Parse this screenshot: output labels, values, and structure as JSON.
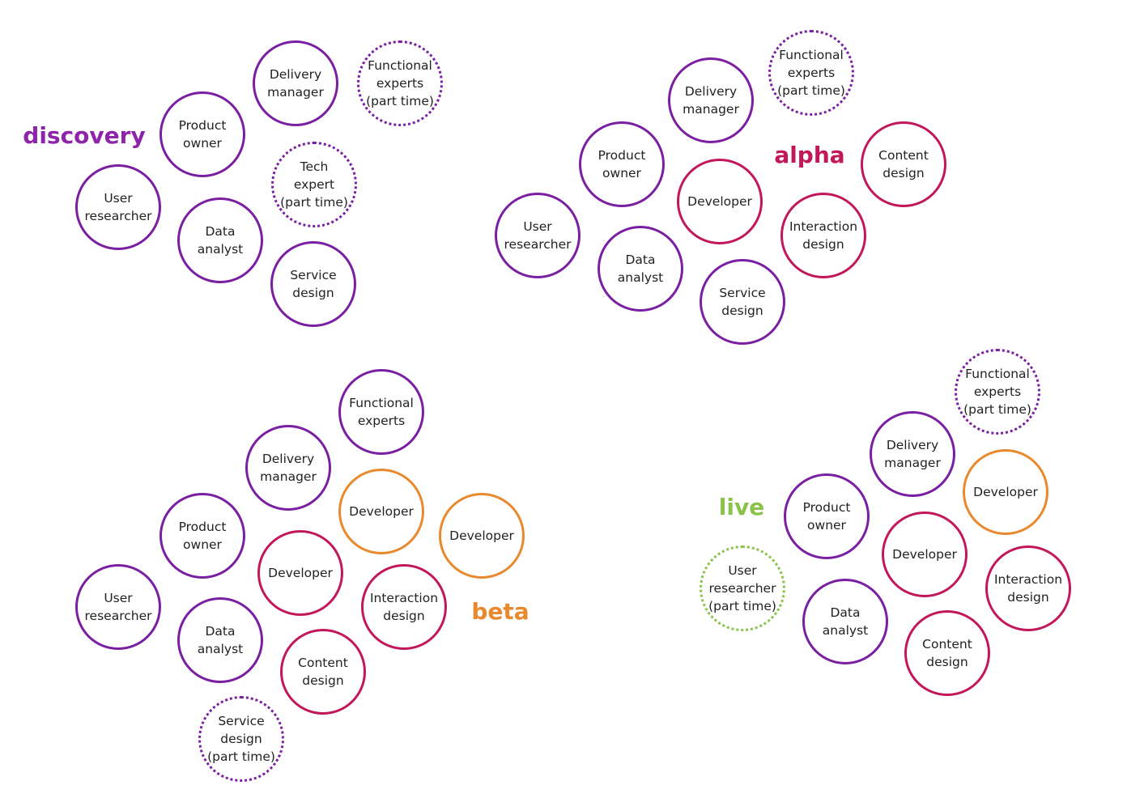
{
  "colors": {
    "purple": "#7B1FA2",
    "magenta": "#C2185B",
    "orange": "#E8892D",
    "green": "#8BC34A",
    "discovery_title": "#8E24AA",
    "alpha_title": "#C2185B",
    "beta_title": "#E8892D",
    "live_title": "#8BC34A"
  },
  "phases": [
    {
      "id": "discovery",
      "title": "discovery",
      "roles": [
        {
          "label": "Delivery\nmanager",
          "color": "purple",
          "style": "solid"
        },
        {
          "label": "Functional\nexperts\n(part time)",
          "color": "purple",
          "style": "dotted"
        },
        {
          "label": "Product\nowner",
          "color": "purple",
          "style": "solid"
        },
        {
          "label": "Tech\nexpert\n(part time)",
          "color": "purple",
          "style": "dotted"
        },
        {
          "label": "User\nresearcher",
          "color": "purple",
          "style": "solid"
        },
        {
          "label": "Data\nanalyst",
          "color": "purple",
          "style": "solid"
        },
        {
          "label": "Service\ndesign",
          "color": "purple",
          "style": "solid"
        }
      ]
    },
    {
      "id": "alpha",
      "title": "alpha",
      "roles": [
        {
          "label": "Functional\nexperts\n(part time)",
          "color": "purple",
          "style": "dotted"
        },
        {
          "label": "Delivery\nmanager",
          "color": "purple",
          "style": "solid"
        },
        {
          "label": "Product\nowner",
          "color": "purple",
          "style": "solid"
        },
        {
          "label": "Developer",
          "color": "magenta",
          "style": "solid"
        },
        {
          "label": "Content\ndesign",
          "color": "magenta",
          "style": "solid"
        },
        {
          "label": "Interaction\ndesign",
          "color": "magenta",
          "style": "solid"
        },
        {
          "label": "User\nresearcher",
          "color": "purple",
          "style": "solid"
        },
        {
          "label": "Data\nanalyst",
          "color": "purple",
          "style": "solid"
        },
        {
          "label": "Service\ndesign",
          "color": "purple",
          "style": "solid"
        }
      ]
    },
    {
      "id": "beta",
      "title": "beta",
      "roles": [
        {
          "label": "Functional\nexperts",
          "color": "purple",
          "style": "solid"
        },
        {
          "label": "Delivery\nmanager",
          "color": "purple",
          "style": "solid"
        },
        {
          "label": "Developer",
          "color": "orange",
          "style": "solid"
        },
        {
          "label": "Developer",
          "color": "orange",
          "style": "solid"
        },
        {
          "label": "Product\nowner",
          "color": "purple",
          "style": "solid"
        },
        {
          "label": "Developer",
          "color": "magenta",
          "style": "solid"
        },
        {
          "label": "Interaction\ndesign",
          "color": "magenta",
          "style": "solid"
        },
        {
          "label": "User\nresearcher",
          "color": "purple",
          "style": "solid"
        },
        {
          "label": "Data\nanalyst",
          "color": "purple",
          "style": "solid"
        },
        {
          "label": "Content\ndesign",
          "color": "magenta",
          "style": "solid"
        },
        {
          "label": "Service\ndesign\n(part time)",
          "color": "purple",
          "style": "dotted"
        }
      ]
    },
    {
      "id": "live",
      "title": "live",
      "roles": [
        {
          "label": "Functional\nexperts\n(part time)",
          "color": "purple",
          "style": "dotted"
        },
        {
          "label": "Delivery\nmanager",
          "color": "purple",
          "style": "solid"
        },
        {
          "label": "Developer",
          "color": "orange",
          "style": "solid"
        },
        {
          "label": "Product\nowner",
          "color": "purple",
          "style": "solid"
        },
        {
          "label": "Developer",
          "color": "magenta",
          "style": "solid"
        },
        {
          "label": "Interaction\ndesign",
          "color": "magenta",
          "style": "solid"
        },
        {
          "label": "User\nresearcher\n(part time)",
          "color": "green",
          "style": "dotted"
        },
        {
          "label": "Data\nanalyst",
          "color": "purple",
          "style": "solid"
        },
        {
          "label": "Content\ndesign",
          "color": "magenta",
          "style": "solid"
        }
      ]
    }
  ]
}
